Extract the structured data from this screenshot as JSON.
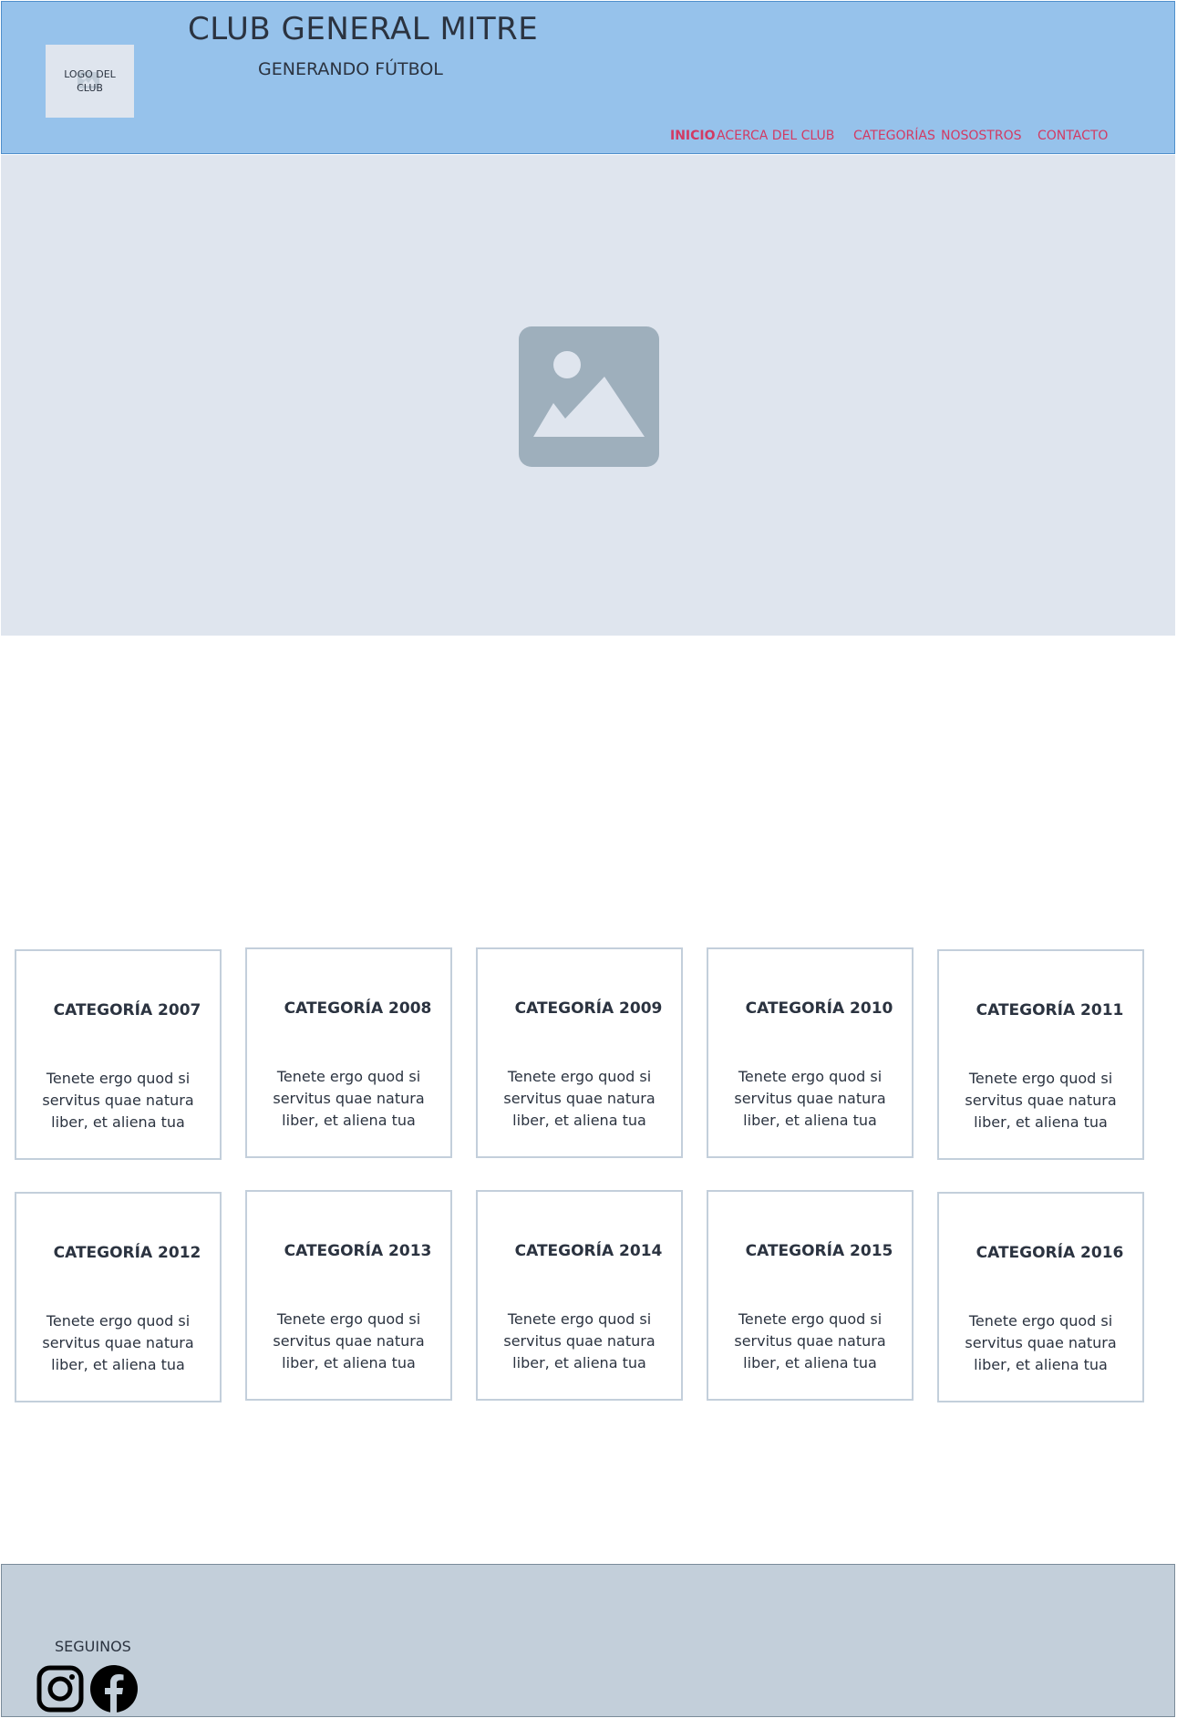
{
  "header": {
    "logo_text": "LOGO DEL CLUB",
    "title": "CLUB GENERAL MITRE",
    "subtitle": "GENERANDO FÚTBOL",
    "nav": [
      {
        "label": "INICIO",
        "active": true
      },
      {
        "label": "ACERCA DEL CLUB",
        "active": false
      },
      {
        "label": "CATEGORÍAS",
        "active": false
      },
      {
        "label": "NOSOSTROS",
        "active": false
      },
      {
        "label": "CONTACTO",
        "active": false
      }
    ]
  },
  "hero": {
    "icon": "image-placeholder-icon"
  },
  "categories": [
    {
      "title": "CATEGORÍA 2007",
      "text": "Tenete ergo quod si servitus quae natura liber, et aliena tua"
    },
    {
      "title": "CATEGORÍA 2008",
      "text": "Tenete ergo quod si servitus quae natura liber, et aliena tua"
    },
    {
      "title": "CATEGORÍA 2009",
      "text": "Tenete ergo quod si servitus quae natura liber, et aliena tua"
    },
    {
      "title": "CATEGORÍA 2010",
      "text": "Tenete ergo quod si servitus quae natura liber, et aliena tua"
    },
    {
      "title": "CATEGORÍA 2011",
      "text": "Tenete ergo quod si servitus quae natura liber, et aliena tua"
    },
    {
      "title": "CATEGORÍA 2012",
      "text": "Tenete ergo quod si servitus quae natura liber, et aliena tua"
    },
    {
      "title": "CATEGORÍA 2013",
      "text": "Tenete ergo quod si servitus quae natura liber, et aliena tua"
    },
    {
      "title": "CATEGORÍA 2014",
      "text": "Tenete ergo quod si servitus quae natura liber, et aliena tua"
    },
    {
      "title": "CATEGORÍA 2015",
      "text": "Tenete ergo quod si servitus quae natura liber, et aliena tua"
    },
    {
      "title": "CATEGORÍA 2016",
      "text": "Tenete ergo quod si servitus quae natura liber, et aliena tua"
    }
  ],
  "footer": {
    "follow_label": "SEGUINOS",
    "social": [
      "instagram-icon",
      "facebook-icon"
    ]
  },
  "colors": {
    "header_bg": "#96c2eb",
    "nav_link": "#d23a63",
    "hero_bg": "#dfe5ee",
    "footer_bg": "#c3cfda",
    "card_border": "#c3cfdb"
  }
}
